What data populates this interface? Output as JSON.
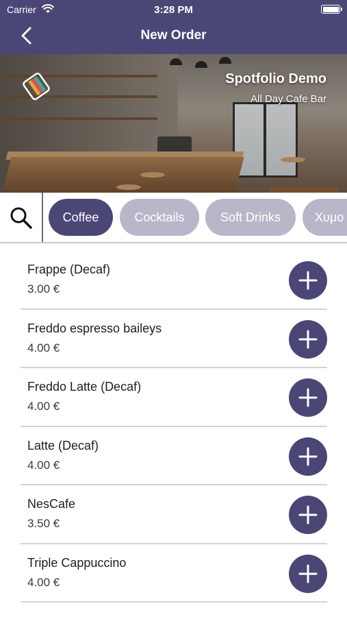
{
  "status_bar": {
    "carrier": "Carrier",
    "time": "3:28 PM",
    "wifi_icon": "wifi-icon",
    "battery_icon": "battery-icon"
  },
  "nav": {
    "title": "New Order",
    "back_icon": "chevron-left-icon"
  },
  "venue": {
    "name": "Spotfolio Demo",
    "subtitle": "All Day Cafe Bar",
    "logo_icon": "spotfolio-logo-icon"
  },
  "categories": {
    "search_icon": "search-icon",
    "items": [
      {
        "label": "Coffee",
        "active": true
      },
      {
        "label": "Cocktails",
        "active": false
      },
      {
        "label": "Soft Drinks",
        "active": false
      },
      {
        "label": "Χυμο",
        "active": false
      }
    ]
  },
  "products": [
    {
      "name": "Frappe (Decaf)",
      "price": "3.00 €"
    },
    {
      "name": "Freddo espresso baileys",
      "price": "4.00 €"
    },
    {
      "name": "Freddo Latte (Decaf)",
      "price": "4.00 €"
    },
    {
      "name": "Latte (Decaf)",
      "price": "4.00 €"
    },
    {
      "name": "NesCafe",
      "price": "3.50 €"
    },
    {
      "name": "Triple Cappuccino",
      "price": "4.00 €"
    }
  ],
  "colors": {
    "brand": "#4a4777",
    "chip_inactive": "#b8b6c8",
    "divider": "#d3d3d6"
  }
}
